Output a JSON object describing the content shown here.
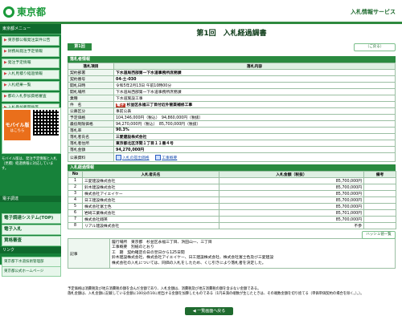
{
  "header": {
    "logo_text": "東京都",
    "service_name": "入札情報サービス"
  },
  "sidebar": {
    "head1": "東京都メニュー",
    "items": [
      "東京都公報発注案件公告",
      "財務局発注予定情報",
      "発注予定情報",
      "入札見積り経過情報",
      "入札結果一覧",
      "都の入札参加資格審査",
      "入札参加者関係等"
    ],
    "mobile_title": "モバイル版",
    "mobile_sub": "はこちら",
    "mobile_note": "モバイル版は、発注予定情報と入札（見積）経過情報に対応しています。",
    "head2": "電子調達",
    "big_items": [
      "電子調達システム(TOP)",
      "電子入札",
      "資格審査"
    ],
    "head3": "リンク",
    "links": [
      "東京都下水道技術管理部",
      "東京都公式ホームページ"
    ]
  },
  "main": {
    "title": "第1回　入札経過調書",
    "round_tab": "第1回",
    "back_button": "（ご戻る）",
    "info_section": "落札者情報",
    "col_item": "落札項目",
    "col_content": "落札内容",
    "rows": [
      {
        "label": "契約部署",
        "value": "下水道局西部第一下水道事務所庶務課",
        "bold": true
      },
      {
        "label": "契約番号",
        "value": "04-土-030",
        "bold": true
      },
      {
        "label": "開札日時",
        "value": "令和5年2月13日 午前10時00分",
        "bold": false
      },
      {
        "label": "開札場所",
        "value": "下水道局西部第一下水道事務所庶務課",
        "bold": false
      },
      {
        "label": "業種",
        "value": "下水道施設工事",
        "bold": false
      },
      {
        "label": "件　名",
        "value": "杉並区永福三丁目付近外管渠補修工事",
        "bold": true,
        "tag": "電子"
      },
      {
        "label": "公募区分",
        "value": "事前公表",
        "bold": false
      },
      {
        "label": "予定価格",
        "value": "104,346,000円（税込）　94,860,000円（税抜）",
        "bold": false
      },
      {
        "label": "最低制限価格",
        "value": "94,270,000円（税込）　85,700,000円（税抜）",
        "bold": false
      },
      {
        "label": "落札率",
        "value": "90.3%",
        "bold": true
      },
      {
        "label": "落札者氏名",
        "value": "三愛建設株式会社",
        "bold": true
      },
      {
        "label": "落札者住所",
        "value": "東京都北区浮間１丁目１１番４号",
        "bold": true
      },
      {
        "label": "落札金額",
        "value": "94,270,000円",
        "bold": true
      }
    ],
    "publication_label": "公表資料",
    "doc_links": [
      "入札の提出価格",
      "工事概要"
    ],
    "bid_section": "入札経過情報",
    "bid_headers": [
      "No",
      "入札者氏名",
      "入札金額（税抜）",
      "備考"
    ],
    "bids": [
      {
        "no": "1",
        "name": "三愛建設株式会社",
        "amount": "85,700,000円",
        "note": ""
      },
      {
        "no": "2",
        "name": "鈴木建設株式会社",
        "amount": "85,700,000円",
        "note": ""
      },
      {
        "no": "3",
        "name": "株式会社アイエイケー",
        "amount": "85,700,000円",
        "note": ""
      },
      {
        "no": "4",
        "name": "日工建設株式会社",
        "amount": "85,700,000円",
        "note": ""
      },
      {
        "no": "5",
        "name": "株式会社富士色",
        "amount": "85,700,000円",
        "note": ""
      },
      {
        "no": "6",
        "name": "岩崎工業株式会社",
        "amount": "85,701,000円",
        "note": ""
      },
      {
        "no": "7",
        "name": "株式会社翔英",
        "amount": "85,700,000円",
        "note": ""
      },
      {
        "no": "8",
        "name": "リアル建設株式会社",
        "amount": "不参",
        "note": ""
      }
    ],
    "history_button": "ハッシュ値一覧",
    "remarks_label": "記事",
    "remarks": [
      "履行場所　東京都　杉並区永福三丁目、浜田山一、三丁目",
      "工事概要　別紙のとおり",
      "工　期　契約確定の日の翌日から125日間",
      "鈴木建設株式会社、株式会社アイエイケー、日工建設株式会社、株式会社富士色及び三愛建設",
      "株式会社の入札については、同価の入札をしたため、くじ引きにより落札者を決定した。"
    ]
  },
  "footer": {
    "notes": [
      "予定価格は消費税及び地方消費税の額を含んだ金額であり、入札金額は、消費税及び地方消費税の額を含まない金額である。",
      "落札金額は、入札金額に記載している金額に100分の10に相当する金額を加算したものである（1円未満の端数が生じたときは、その端数金額を切り捨てる（単価単価契約の場合を除く。）。）。"
    ],
    "list_button": "◀ 一覧画面へ戻る"
  }
}
